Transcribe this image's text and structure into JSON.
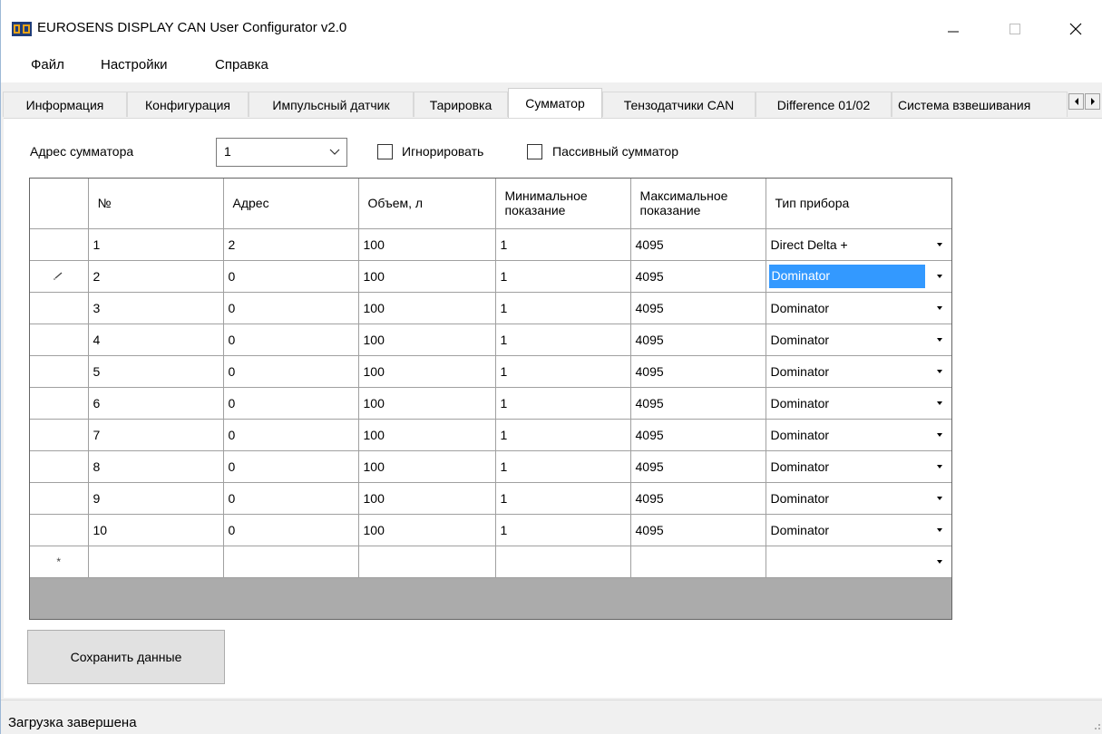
{
  "window": {
    "title": "EUROSENS DISPLAY CAN User Configurator v2.0"
  },
  "menu": [
    "Файл",
    "Настройки",
    "Справка"
  ],
  "tabs": [
    {
      "label": "Информация",
      "active": false
    },
    {
      "label": "Конфигурация",
      "active": false
    },
    {
      "label": "Импульсный датчик",
      "active": false
    },
    {
      "label": "Тарировка",
      "active": false
    },
    {
      "label": "Сумматор",
      "active": true
    },
    {
      "label": "Тензодатчики CAN",
      "active": false
    },
    {
      "label": "Difference 01/02",
      "active": false
    },
    {
      "label": "Система взвешивания",
      "active": false
    }
  ],
  "form": {
    "address_label": "Адрес сумматора",
    "address_value": "1",
    "ignore_label": "Игнорировать",
    "ignore_checked": false,
    "passive_label": "Пассивный сумматор",
    "passive_checked": false
  },
  "grid": {
    "columns": [
      "№",
      "Адрес",
      "Объем, л",
      "Минимальное показание",
      "Максимальное показание",
      "Тип прибора"
    ],
    "rows": [
      {
        "marker": "",
        "num": "1",
        "addr": "2",
        "vol": "100",
        "min": "1",
        "max": "4095",
        "type": "Direct Delta +",
        "selected": false
      },
      {
        "marker": "edit",
        "num": "2",
        "addr": "0",
        "vol": "100",
        "min": "1",
        "max": "4095",
        "type": "Dominator",
        "selected": true
      },
      {
        "marker": "",
        "num": "3",
        "addr": "0",
        "vol": "100",
        "min": "1",
        "max": "4095",
        "type": "Dominator",
        "selected": false
      },
      {
        "marker": "",
        "num": "4",
        "addr": "0",
        "vol": "100",
        "min": "1",
        "max": "4095",
        "type": "Dominator",
        "selected": false
      },
      {
        "marker": "",
        "num": "5",
        "addr": "0",
        "vol": "100",
        "min": "1",
        "max": "4095",
        "type": "Dominator",
        "selected": false
      },
      {
        "marker": "",
        "num": "6",
        "addr": "0",
        "vol": "100",
        "min": "1",
        "max": "4095",
        "type": "Dominator",
        "selected": false
      },
      {
        "marker": "",
        "num": "7",
        "addr": "0",
        "vol": "100",
        "min": "1",
        "max": "4095",
        "type": "Dominator",
        "selected": false
      },
      {
        "marker": "",
        "num": "8",
        "addr": "0",
        "vol": "100",
        "min": "1",
        "max": "4095",
        "type": "Dominator",
        "selected": false
      },
      {
        "marker": "",
        "num": "9",
        "addr": "0",
        "vol": "100",
        "min": "1",
        "max": "4095",
        "type": "Dominator",
        "selected": false
      },
      {
        "marker": "",
        "num": "10",
        "addr": "0",
        "vol": "100",
        "min": "1",
        "max": "4095",
        "type": "Dominator",
        "selected": false
      },
      {
        "marker": "new",
        "num": "",
        "addr": "",
        "vol": "",
        "min": "",
        "max": "",
        "type": "",
        "selected": false
      }
    ]
  },
  "save_button": "Сохранить данные",
  "status": "Загрузка завершена",
  "colors": {
    "selection": "#3399ff",
    "grid_empty": "#ababab"
  }
}
